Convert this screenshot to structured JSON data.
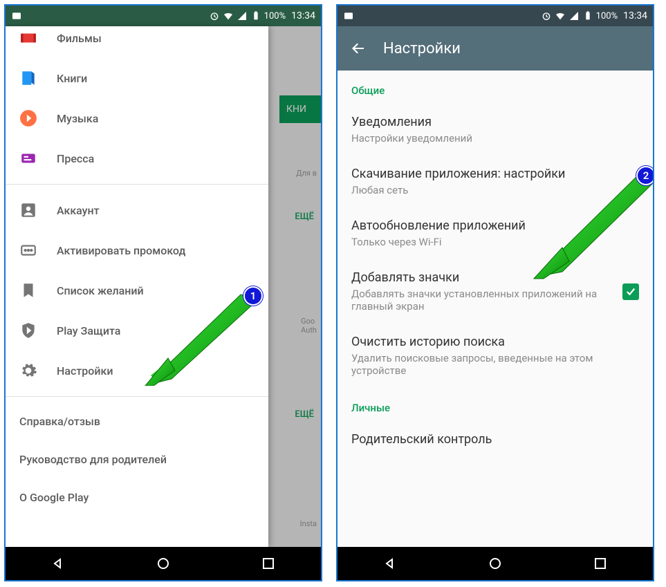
{
  "status": {
    "battery": "100%",
    "time": "13:34"
  },
  "left": {
    "drawer": {
      "items": [
        {
          "label": "Фильмы",
          "icon": "film"
        },
        {
          "label": "Книги",
          "icon": "book"
        },
        {
          "label": "Музыка",
          "icon": "music"
        },
        {
          "label": "Пресса",
          "icon": "press"
        }
      ],
      "account_items": [
        {
          "label": "Аккаунт",
          "icon": "account"
        },
        {
          "label": "Активировать промокод",
          "icon": "promo"
        },
        {
          "label": "Список желаний",
          "icon": "wishlist"
        },
        {
          "label": "Play Защита",
          "icon": "protect"
        },
        {
          "label": "Настройки",
          "icon": "settings"
        }
      ],
      "footer_items": [
        {
          "label": "Справка/отзыв"
        },
        {
          "label": "Руководство для родителей"
        },
        {
          "label": "О Google Play"
        }
      ]
    },
    "behind": {
      "green_tab": "КНИ",
      "placeholder": "Для в",
      "more": "ЕЩЁ",
      "app1a": "Goo",
      "app1b": "Auth",
      "app2": "Insta"
    },
    "annotation_badge": "1"
  },
  "right": {
    "appbar_title": "Настройки",
    "section1": "Общие",
    "settings": [
      {
        "title": "Уведомления",
        "sub": "Настройки уведомлений"
      },
      {
        "title": "Скачивание приложения: настройки",
        "sub": "Любая сеть"
      },
      {
        "title": "Автообновление приложений",
        "sub": "Только через Wi-Fi"
      },
      {
        "title": "Добавлять значки",
        "sub": "Добавлять значки установленных приложений на главный экран",
        "checked": true
      },
      {
        "title": "Очистить историю поиска",
        "sub": "Удалить поисковые запросы, введенные на этом устройстве"
      }
    ],
    "section2": "Личные",
    "settings2": [
      {
        "title": "Родительский контроль"
      }
    ],
    "annotation_badge": "2"
  }
}
